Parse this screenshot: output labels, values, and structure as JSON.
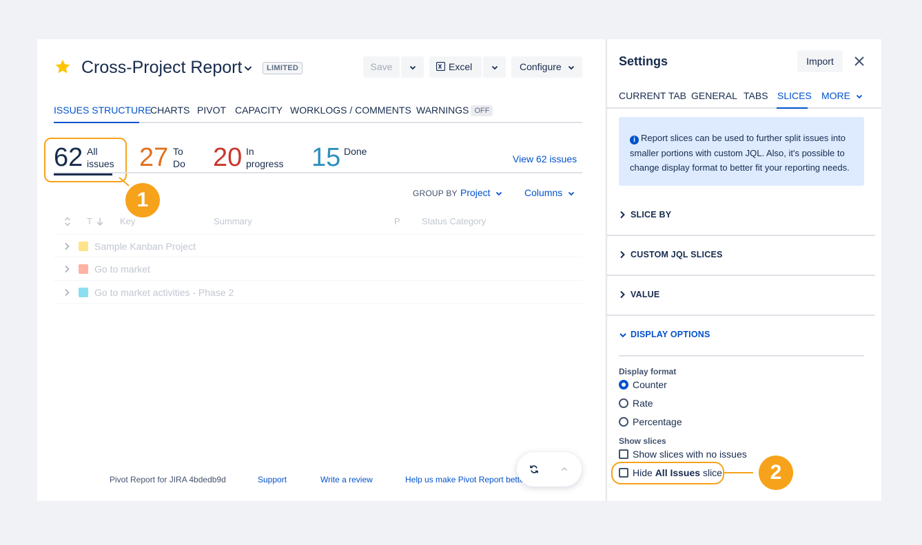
{
  "report": {
    "title": "Cross-Project Report",
    "badge": "LIMITED"
  },
  "toolbar": {
    "save_label": "Save",
    "excel_label": "Excel",
    "configure_label": "Configure"
  },
  "tabs": [
    {
      "label": "ISSUES STRUCTURE",
      "active": true
    },
    {
      "label": "CHARTS"
    },
    {
      "label": "PIVOT"
    },
    {
      "label": "CAPACITY"
    },
    {
      "label": "WORKLOGS / COMMENTS"
    },
    {
      "label": "WARNINGS",
      "badge": "OFF"
    }
  ],
  "counters": [
    {
      "value": "62",
      "label_line1": "All",
      "label_line2": "issues",
      "color": "#172b4d"
    },
    {
      "value": "27",
      "label_line1": "To",
      "label_line2": "Do",
      "color": "#e2711d"
    },
    {
      "value": "20",
      "label_line1": "In",
      "label_line2": "progress",
      "color": "#c9372c"
    },
    {
      "value": "15",
      "label_line1": "Done",
      "label_line2": "",
      "color": "#2d8fbf"
    }
  ],
  "view_link": "View 62 issues",
  "group_by": {
    "label": "GROUP BY",
    "value": "Project",
    "columns_label": "Columns"
  },
  "table": {
    "headers": [
      "T",
      "Key",
      "Summary",
      "P",
      "Status Category"
    ],
    "rows": [
      {
        "text": "Sample Kanban Project",
        "icon": "project-icon-yellow"
      },
      {
        "text": "Go to market",
        "icon": "project-icon-red"
      },
      {
        "text": "Go to market activities - Phase 2",
        "icon": "project-icon-blue"
      }
    ]
  },
  "footer": {
    "version": "Pivot Report for JIRA 4bdedb9d",
    "support": "Support",
    "review": "Write a review",
    "help": "Help us make Pivot Report bette"
  },
  "callouts": {
    "one": "1",
    "two": "2"
  },
  "settings": {
    "title": "Settings",
    "import_label": "Import",
    "tabs": [
      {
        "label": "CURRENT TAB"
      },
      {
        "label": "GENERAL"
      },
      {
        "label": "TABS"
      },
      {
        "label": "SLICES",
        "active": true
      },
      {
        "label": "MORE"
      }
    ],
    "info_text": "Report slices can be used to further split issues into smaller portions with custom JQL. Also, it's possible to change display format to better fit your reporting needs.",
    "sections": [
      {
        "label": "SLICE BY",
        "expanded": false
      },
      {
        "label": "CUSTOM JQL SLICES",
        "expanded": false
      },
      {
        "label": "VALUE",
        "expanded": false
      },
      {
        "label": "DISPLAY OPTIONS",
        "expanded": true
      }
    ],
    "display_format": {
      "label": "Display format",
      "options": [
        {
          "label": "Counter",
          "selected": true
        },
        {
          "label": "Rate",
          "selected": false
        },
        {
          "label": "Percentage",
          "selected": false
        }
      ]
    },
    "show_slices": {
      "label": "Show slices",
      "option_no_issues": "Show slices with no issues",
      "option_hide_prefix": "Hide",
      "option_hide_bold": "All Issues",
      "option_hide_suffix": "slice"
    }
  },
  "colors": {
    "accent": "#0052cc",
    "callout": "#f7a21b"
  }
}
